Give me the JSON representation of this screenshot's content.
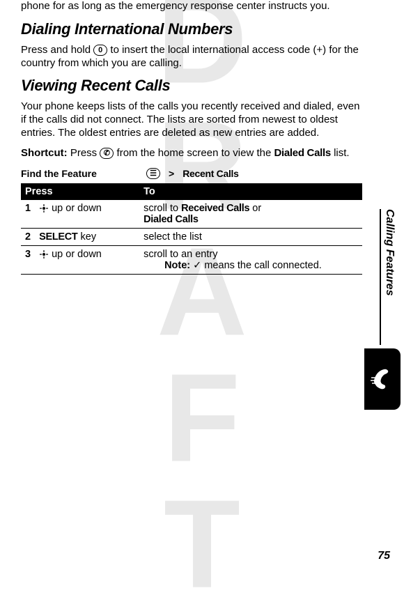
{
  "watermark": "DRAFT",
  "topPara": "phone for as long as the emergency response center instructs you.",
  "sec1": {
    "title": "Dialing International Numbers",
    "body_a": "Press and hold ",
    "key0": "0",
    "body_b": " to insert the local international access code (+) for the country from which you are calling."
  },
  "sec2": {
    "title": "Viewing Recent Calls",
    "body": "Your phone keeps lists of the calls you recently received and dialed, even if the calls did not connect. The lists are sorted from newest to oldest entries. The oldest entries are deleted as new entries are added.",
    "shortcut_label": "Shortcut:",
    "shortcut_a": " Press ",
    "shortcut_key": "✆",
    "shortcut_b": " from the home screen to view the ",
    "shortcut_menu": "Dialed Calls",
    "shortcut_c": " list."
  },
  "feature": {
    "label": "Find the Feature",
    "menu_key": "☰",
    "gt": ">",
    "path1": "Recent Calls"
  },
  "table": {
    "h1": "Press",
    "h2": "To",
    "rows": [
      {
        "n": "1",
        "press_suffix": " up or down",
        "to_a": "scroll to ",
        "to_m1": "Received Calls",
        "to_b": " or ",
        "to_m2": "Dialed Calls"
      },
      {
        "n": "2",
        "press_menu": "SELECT",
        "press_suffix": " key",
        "to": "select the list"
      },
      {
        "n": "3",
        "press_suffix": " up or down",
        "to": "scroll to an entry",
        "note_label": "Note:",
        "note_check": "✓",
        "note_body": " means the call connected."
      }
    ]
  },
  "side": "Calling Features",
  "page": "75"
}
